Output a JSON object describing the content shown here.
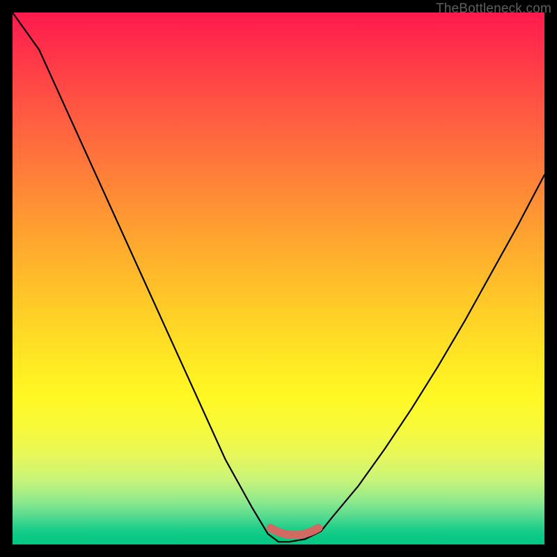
{
  "watermark": "TheBottleneck.com",
  "chart_data": {
    "type": "line",
    "title": "",
    "xlabel": "",
    "ylabel": "",
    "xlim": [
      0,
      1
    ],
    "ylim": [
      0,
      1
    ],
    "series": [
      {
        "name": "bottleneck-curve",
        "x": [
          0.0,
          0.05,
          0.1,
          0.15,
          0.2,
          0.25,
          0.3,
          0.35,
          0.4,
          0.45,
          0.48,
          0.5,
          0.52,
          0.55,
          0.58,
          0.6,
          0.65,
          0.7,
          0.75,
          0.8,
          0.85,
          0.9,
          0.95,
          1.0
        ],
        "y": [
          1.0,
          0.93,
          0.82,
          0.71,
          0.6,
          0.49,
          0.38,
          0.27,
          0.16,
          0.07,
          0.02,
          0.005,
          0.005,
          0.01,
          0.025,
          0.05,
          0.11,
          0.18,
          0.255,
          0.335,
          0.42,
          0.51,
          0.6,
          0.695
        ]
      }
    ],
    "flat_segment": {
      "x_start": 0.485,
      "x_end": 0.575,
      "y": 0.018,
      "color": "#d16a62",
      "thickness_px": 12
    },
    "colors": {
      "curve": "#000000",
      "background_top": "#ff1a4d",
      "background_bottom": "#04c682",
      "frame": "#000000",
      "watermark": "#5f5f5f"
    }
  }
}
